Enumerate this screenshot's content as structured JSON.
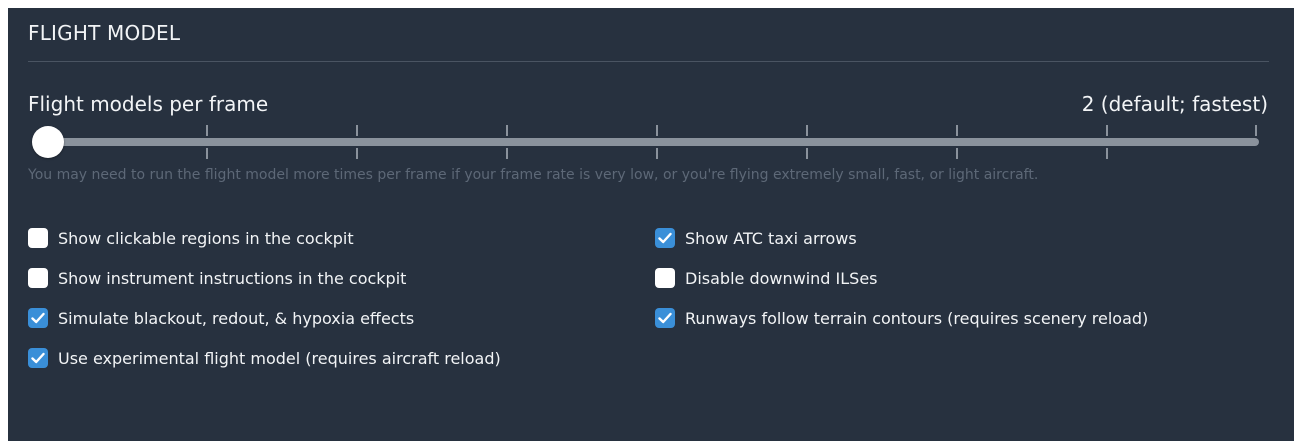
{
  "section": {
    "title": "FLIGHT MODEL"
  },
  "flight_models": {
    "label": "Flight models per frame",
    "value": "2 (default; fastest)",
    "slider_position": 0,
    "hint": "You may need to run the flight model more times per frame if your frame rate is very low, or you're flying extremely small, fast, or light aircraft."
  },
  "options": {
    "clickable_regions": {
      "label": "Show clickable regions in the cockpit",
      "checked": false
    },
    "instrument_instructions": {
      "label": "Show instrument instructions in the cockpit",
      "checked": false
    },
    "blackout_effects": {
      "label": "Simulate blackout, redout, & hypoxia effects",
      "checked": true
    },
    "experimental_fm": {
      "label": "Use experimental flight model (requires aircraft reload)",
      "checked": true
    },
    "atc_taxi_arrows": {
      "label": "Show ATC taxi arrows",
      "checked": true
    },
    "downwind_ils": {
      "label": "Disable downwind ILSes",
      "checked": false
    },
    "runway_contours": {
      "label": "Runways follow terrain contours (requires scenery reload)",
      "checked": true
    }
  },
  "colors": {
    "panel_bg": "#27313f",
    "accent_checked": "#3a8fd8",
    "text": "#f2f4f6",
    "hint_text": "#5d6877"
  }
}
